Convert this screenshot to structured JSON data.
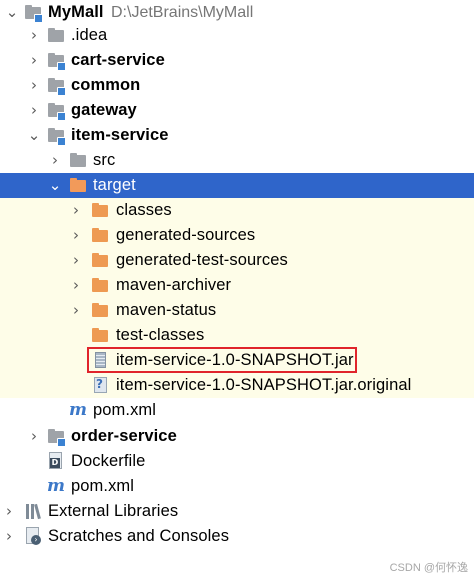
{
  "tree": {
    "root": {
      "label": "MyMall",
      "path": "D:\\JetBrains\\MyMall"
    },
    "rows": [
      {
        "name": "tree-item-mymall",
        "label": "MyMall",
        "bold": true,
        "icon": "folder-module-icon",
        "chevron": "down"
      },
      {
        "name": "tree-item-idea",
        "label": ".idea",
        "bold": false,
        "icon": "folder-icon",
        "chevron": "right"
      },
      {
        "name": "tree-item-cart-service",
        "label": "cart-service",
        "bold": true,
        "icon": "folder-module-icon",
        "chevron": "right"
      },
      {
        "name": "tree-item-common",
        "label": "common",
        "bold": true,
        "icon": "folder-module-icon",
        "chevron": "right"
      },
      {
        "name": "tree-item-gateway",
        "label": "gateway",
        "bold": true,
        "icon": "folder-module-icon",
        "chevron": "right"
      },
      {
        "name": "tree-item-item-service",
        "label": "item-service",
        "bold": true,
        "icon": "folder-module-icon",
        "chevron": "down"
      },
      {
        "name": "tree-item-src",
        "label": "src",
        "bold": false,
        "icon": "folder-icon",
        "chevron": "right"
      },
      {
        "name": "tree-item-target",
        "label": "target",
        "bold": false,
        "icon": "excluded-folder-icon",
        "chevron": "down",
        "selected": true
      },
      {
        "name": "tree-item-classes",
        "label": "classes",
        "bold": false,
        "icon": "excluded-folder-icon",
        "chevron": "right"
      },
      {
        "name": "tree-item-generated-sources",
        "label": "generated-sources",
        "bold": false,
        "icon": "excluded-folder-icon",
        "chevron": "right"
      },
      {
        "name": "tree-item-generated-test-sources",
        "label": "generated-test-sources",
        "bold": false,
        "icon": "excluded-folder-icon",
        "chevron": "right"
      },
      {
        "name": "tree-item-maven-archiver",
        "label": "maven-archiver",
        "bold": false,
        "icon": "excluded-folder-icon",
        "chevron": "right"
      },
      {
        "name": "tree-item-maven-status",
        "label": "maven-status",
        "bold": false,
        "icon": "excluded-folder-icon",
        "chevron": "right"
      },
      {
        "name": "tree-item-test-classes",
        "label": "test-classes",
        "bold": false,
        "icon": "excluded-folder-icon",
        "chevron": "none"
      },
      {
        "name": "tree-item-jar",
        "label": "item-service-1.0-SNAPSHOT.jar",
        "bold": false,
        "icon": "jar-icon",
        "chevron": "none",
        "highlighted": true
      },
      {
        "name": "tree-item-jar-original",
        "label": "item-service-1.0-SNAPSHOT.jar.original",
        "bold": false,
        "icon": "unknown-file-icon",
        "chevron": "none"
      },
      {
        "name": "tree-item-item-service-pom",
        "label": "pom.xml",
        "bold": false,
        "icon": "maven-icon",
        "chevron": "none"
      },
      {
        "name": "tree-item-order-service",
        "label": "order-service",
        "bold": true,
        "icon": "folder-module-icon",
        "chevron": "right"
      },
      {
        "name": "tree-item-dockerfile",
        "label": "Dockerfile",
        "bold": false,
        "icon": "dockerfile-icon",
        "chevron": "none"
      },
      {
        "name": "tree-item-root-pom",
        "label": "pom.xml",
        "bold": false,
        "icon": "maven-icon",
        "chevron": "none"
      },
      {
        "name": "tree-item-external-libraries",
        "label": "External Libraries",
        "bold": false,
        "icon": "libraries-icon",
        "chevron": "right"
      },
      {
        "name": "tree-item-scratches",
        "label": "Scratches and Consoles",
        "bold": false,
        "icon": "scratches-icon",
        "chevron": "right"
      }
    ]
  },
  "colors": {
    "selection": "#2f65ca",
    "excluded_background": "#fefde8",
    "highlight_border": "#e0242b",
    "excluded_folder": "#ee9a52",
    "folder": "#9fa3a8"
  },
  "watermark": "CSDN @何怀逸"
}
